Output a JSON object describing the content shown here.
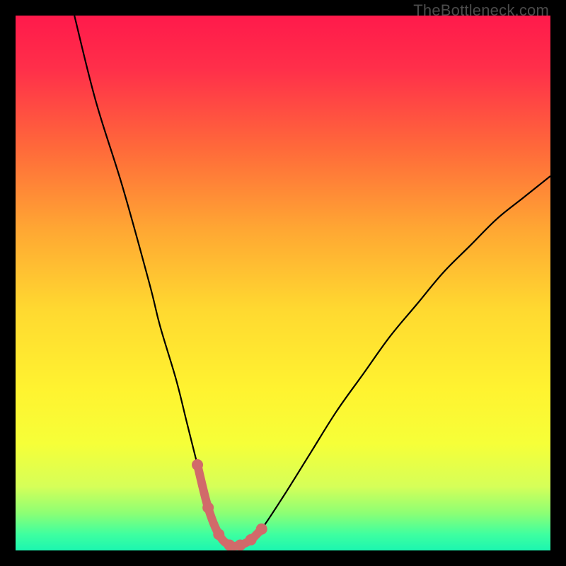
{
  "watermark": {
    "text": "TheBottleneck.com"
  },
  "colors": {
    "background": "#000000",
    "curve_stroke": "#000000",
    "highlight_stroke": "#d16a6a",
    "highlight_fill": "#d16a6a",
    "gradient_stops": [
      {
        "offset": 0.0,
        "color": "#ff1a4b"
      },
      {
        "offset": 0.1,
        "color": "#ff2f4a"
      },
      {
        "offset": 0.25,
        "color": "#ff6a3a"
      },
      {
        "offset": 0.4,
        "color": "#ffa733"
      },
      {
        "offset": 0.55,
        "color": "#ffd930"
      },
      {
        "offset": 0.7,
        "color": "#fff330"
      },
      {
        "offset": 0.8,
        "color": "#f6ff38"
      },
      {
        "offset": 0.88,
        "color": "#d6ff58"
      },
      {
        "offset": 0.93,
        "color": "#8dff74"
      },
      {
        "offset": 0.97,
        "color": "#3effa0"
      },
      {
        "offset": 1.0,
        "color": "#1cf6b0"
      }
    ]
  },
  "chart_data": {
    "type": "line",
    "title": "",
    "xlabel": "",
    "ylabel": "",
    "x_range": [
      0,
      100
    ],
    "y_range": [
      0,
      100
    ],
    "series": [
      {
        "name": "bottleneck-curve",
        "x": [
          11,
          15,
          20,
          25,
          27,
          30,
          32,
          34,
          36,
          38,
          40,
          42,
          44,
          46,
          50,
          55,
          60,
          65,
          70,
          75,
          80,
          85,
          90,
          95,
          100
        ],
        "y": [
          100,
          84,
          68,
          50,
          42,
          32,
          24,
          16,
          8,
          3,
          1,
          1,
          2,
          4,
          10,
          18,
          26,
          33,
          40,
          46,
          52,
          57,
          62,
          66,
          70
        ]
      }
    ],
    "highlight": {
      "name": "optimal-range",
      "x": [
        34,
        36,
        38,
        40,
        42,
        44,
        46
      ],
      "y": [
        16,
        8,
        3,
        1,
        1,
        2,
        4
      ]
    }
  }
}
